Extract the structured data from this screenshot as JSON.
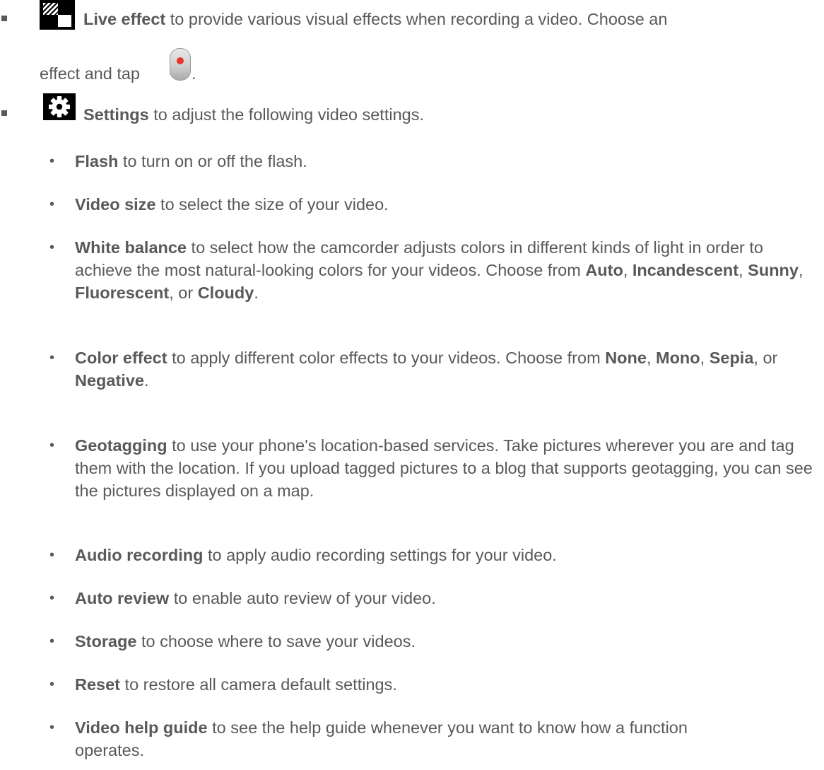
{
  "items": {
    "live_effect": {
      "icon": "live-effect-icon",
      "title": "Live effect",
      "text": " to provide various visual effects when recording a video. Choose an",
      "line2": "effect and tap",
      "line2_end": ".",
      "record_icon": "record-button-icon"
    },
    "settings": {
      "icon": "gear-icon",
      "title": "Settings",
      "text": " to adjust the following video settings."
    }
  },
  "sub": {
    "flash": {
      "title": "Flash",
      "text": " to turn on or off the flash."
    },
    "video_size": {
      "title": "Video size",
      "text": " to select the size of your video."
    },
    "white_balance": {
      "title": "White balance",
      "text1": " to select how the camcorder adjusts colors in different kinds of light in order to achieve the most natural-looking colors for your videos. Choose from ",
      "o1": "Auto",
      "sep1": ", ",
      "o2": "Incandescent",
      "sep2": ", ",
      "o3": "Sunny",
      "sep3": ", ",
      "o4": "Fluorescent",
      "sep4": ", or ",
      "o5": "Cloudy",
      "end": "."
    },
    "color_effect": {
      "title": "Color effect",
      "text1": " to apply different color effects to your videos. Choose from ",
      "o1": "None",
      "sep1": ", ",
      "o2": "Mono",
      "sep2": ", ",
      "o3": "Sepia",
      "sep3": ", or ",
      "o4": "Negative",
      "end": "."
    },
    "geotagging": {
      "title": "Geotagging",
      "text": " to use your phone's location-based services. Take pictures wherever you are and tag them with the location. If you upload tagged pictures to a blog that supports geotagging, you can see the pictures displayed on a map."
    },
    "audio_recording": {
      "title": "Audio recording",
      "text": " to apply audio recording settings for your video."
    },
    "auto_review": {
      "title": "Auto review",
      "text": " to enable auto review of your video."
    },
    "storage": {
      "title": "Storage",
      "text": " to choose where to save your videos."
    },
    "reset": {
      "title": "Reset",
      "text": " to restore all camera default settings."
    },
    "video_help_guide": {
      "title": "Video help guide",
      "text": " to see the help guide whenever you want to know how a function operates."
    }
  },
  "bullet_char": "•"
}
